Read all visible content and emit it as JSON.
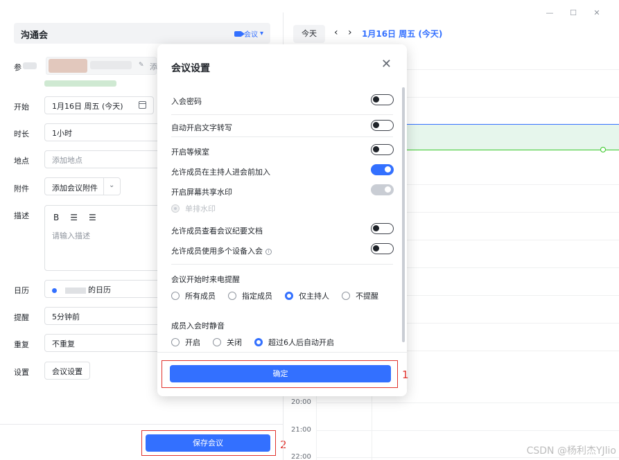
{
  "window": {
    "min_icon": "—",
    "max_icon": "☐",
    "close_icon": "✕"
  },
  "form": {
    "title": "沟通会",
    "meeting_tag": "会议",
    "labels": {
      "participants": "参",
      "start": "开始",
      "duration": "时长",
      "location": "地点",
      "attachment": "附件",
      "description": "描述",
      "calendar": "日历",
      "reminder": "提醒",
      "repeat": "重复",
      "settings": "设置"
    },
    "participants_add_label": "添",
    "start_value": "1月16日 周五 (今天)",
    "duration_value": "1小时",
    "location_placeholder": "添加地点",
    "attachment_button": "添加会议附件",
    "description_placeholder": "请输入描述",
    "calendar_value": "的日历",
    "reminder_value": "5分钟前",
    "repeat_value": "不重复",
    "settings_button": "会议设置",
    "save_button": "保存会议"
  },
  "calendar": {
    "today_button": "今天",
    "prev_icon": "‹",
    "next_icon": "›",
    "date_title": "1月16日 周五 (今天)",
    "time_labels": [
      "20:00",
      "21:00",
      "22:00"
    ]
  },
  "modal": {
    "title": "会议设置",
    "options": {
      "password": "入会密码",
      "transcription": "自动开启文字转写",
      "waiting_room": "开启等候室",
      "join_before_host": "允许成员在主持人进会前加入",
      "watermark": "开启屏幕共享水印",
      "single_watermark": "单排水印",
      "view_minutes": "允许成员查看会议纪要文档",
      "multi_device": "允许成员使用多个设备入会"
    },
    "toggles": {
      "password": false,
      "transcription": false,
      "waiting_room": false,
      "join_before_host": true,
      "watermark": true,
      "view_minutes": false,
      "multi_device": false
    },
    "reminder_section": {
      "title": "会议开始时来电提醒",
      "options": [
        "所有成员",
        "指定成员",
        "仅主持人",
        "不提醒"
      ],
      "selected": "仅主持人"
    },
    "mute_section": {
      "title": "成员入会时静音",
      "options": [
        "开启",
        "关闭",
        "超过6人后自动开启"
      ],
      "selected": "超过6人后自动开启"
    },
    "confirm_button": "确定"
  },
  "annotations": {
    "marker_1": "1",
    "marker_2": "2"
  },
  "watermark_text": "CSDN @杨利杰YJlio",
  "colors": {
    "accent": "#3370ff",
    "annotation_red": "#e0312b",
    "event_green": "#34c724"
  }
}
